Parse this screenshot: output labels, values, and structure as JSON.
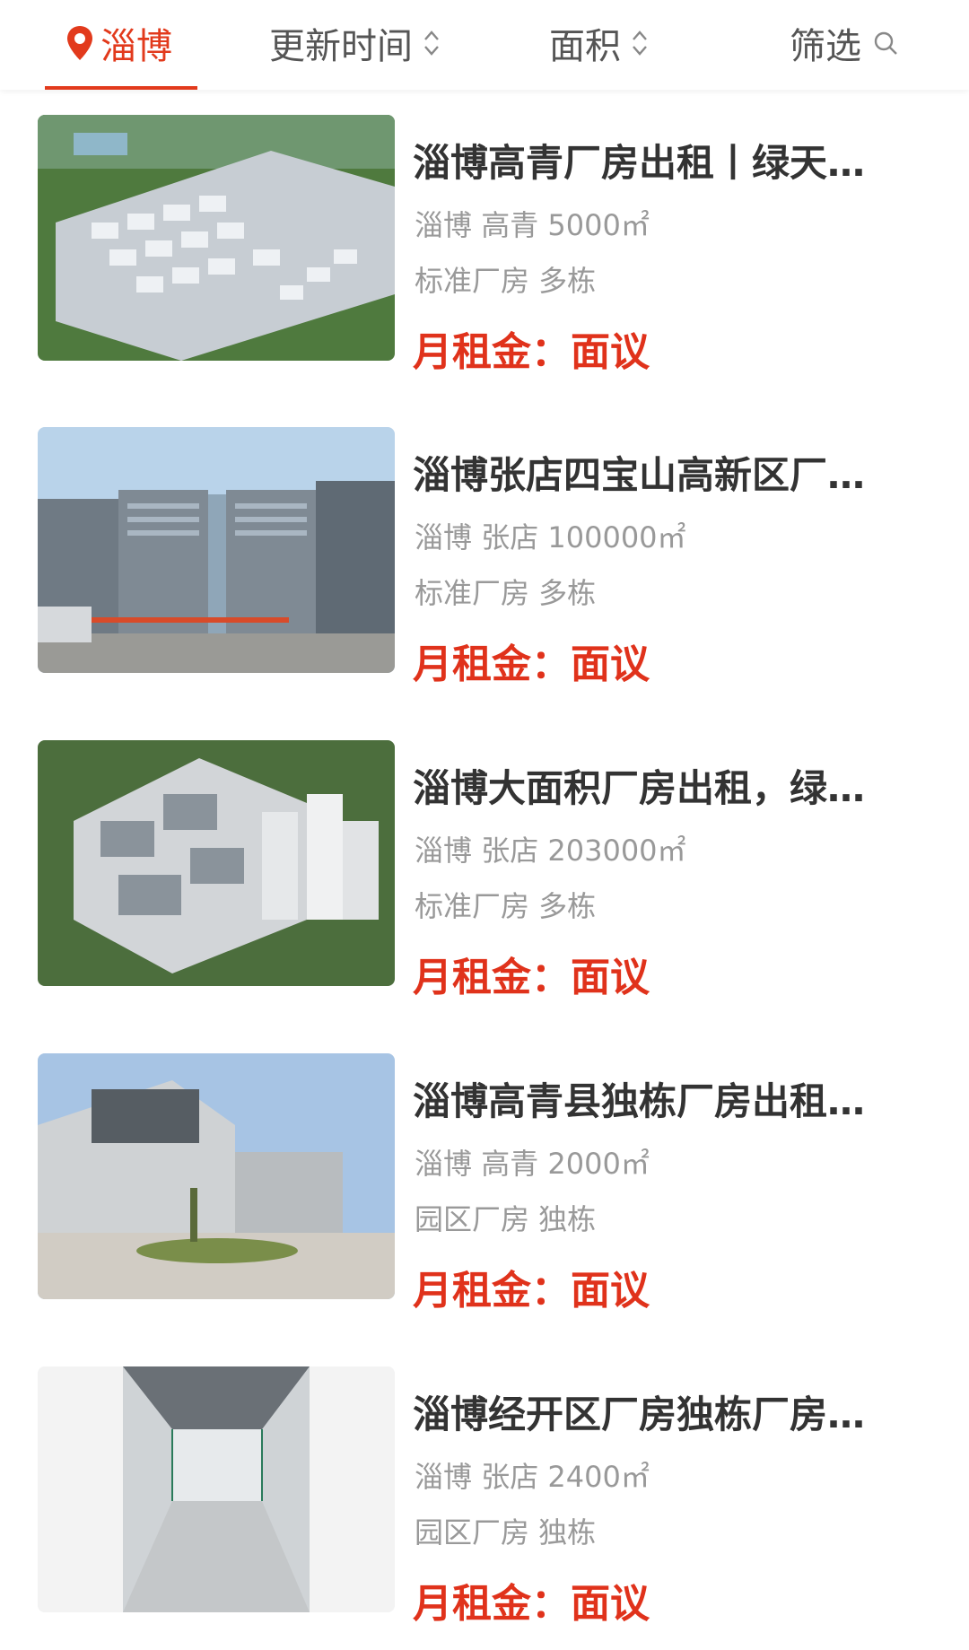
{
  "filters": {
    "city": "淄博",
    "update_time": "更新时间",
    "area": "面积",
    "filter": "筛选"
  },
  "listings": [
    {
      "title": "淄博高青厂房出租丨绿天…",
      "city": "淄博",
      "district": "高青",
      "area": "5000㎡",
      "tags": "标准厂房 多栋",
      "price_label": "月租金：",
      "price_value": "面议"
    },
    {
      "title": "淄博张店四宝山高新区厂…",
      "city": "淄博",
      "district": "张店",
      "area": "100000㎡",
      "tags": "标准厂房 多栋",
      "price_label": "月租金：",
      "price_value": "面议"
    },
    {
      "title": "淄博大面积厂房出租，绿…",
      "city": "淄博",
      "district": "张店",
      "area": "203000㎡",
      "tags": "标准厂房 多栋",
      "price_label": "月租金：",
      "price_value": "面议"
    },
    {
      "title": "淄博高青县独栋厂房出租…",
      "city": "淄博",
      "district": "高青",
      "area": "2000㎡",
      "tags": "园区厂房 独栋",
      "price_label": "月租金：",
      "price_value": "面议"
    },
    {
      "title": "淄博经开区厂房独栋厂房…",
      "city": "淄博",
      "district": "张店",
      "area": "2400㎡",
      "tags": "园区厂房 独栋",
      "price_label": "月租金：",
      "price_value": "面议"
    }
  ],
  "colors": {
    "accent": "#e23a1c",
    "price": "#e0321b"
  }
}
